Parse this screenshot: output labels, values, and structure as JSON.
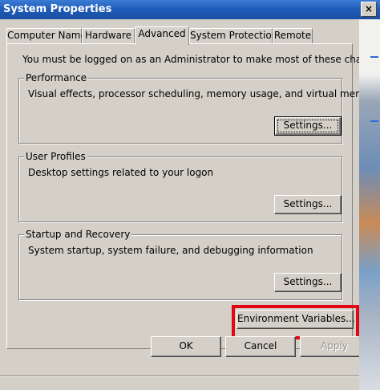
{
  "window": {
    "title": "System Properties",
    "close_label": "×"
  },
  "tabs": [
    {
      "label": "Computer Name",
      "active": false
    },
    {
      "label": "Hardware",
      "active": false
    },
    {
      "label": "Advanced",
      "active": true
    },
    {
      "label": "System Protection",
      "active": false
    },
    {
      "label": "Remote",
      "active": false
    }
  ],
  "advanced": {
    "notice": "You must be logged on as an Administrator to make most of these changes.",
    "performance": {
      "title": "Performance",
      "description": "Visual effects, processor scheduling, memory usage, and virtual memory",
      "button": "Settings..."
    },
    "user_profiles": {
      "title": "User Profiles",
      "description": "Desktop settings related to your logon",
      "button": "Settings..."
    },
    "startup_recovery": {
      "title": "Startup and Recovery",
      "description": "System startup, system failure, and debugging information",
      "button": "Settings..."
    },
    "env_button": "Environment Variables..."
  },
  "footer": {
    "ok": "OK",
    "cancel": "Cancel",
    "apply": "Apply",
    "apply_enabled": false
  },
  "colors": {
    "highlight": "#e30613",
    "titlebar": "#1f5bb8"
  }
}
